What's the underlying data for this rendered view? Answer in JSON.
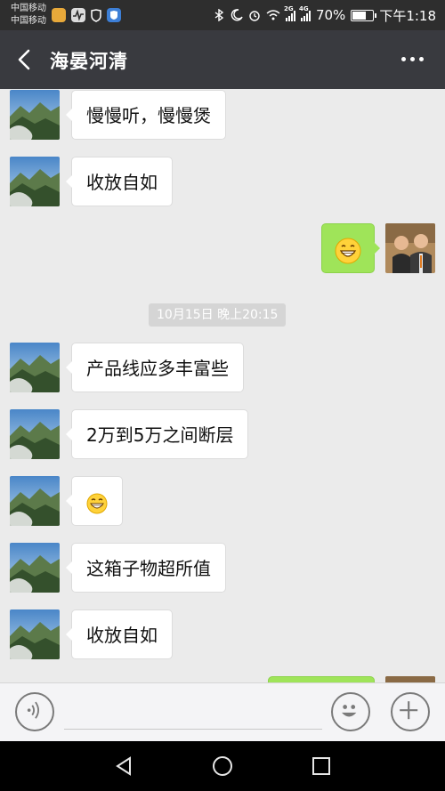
{
  "status_bar": {
    "carrier_1": "中国移动",
    "carrier_2": "中国移动",
    "signal_1_label": "2G",
    "signal_2_label": "4G",
    "battery_text": "70%",
    "battery_level": 0.7,
    "time": "下午1:18"
  },
  "nav": {
    "title": "海晏河清"
  },
  "messages": {
    "m1": "慢慢听，慢慢煲",
    "m2": "收放自如",
    "m3_emoji": "grinning-face-emoji",
    "timestamp": "10月15日 晚上20:15",
    "m4": "产品线应多丰富些",
    "m5": "2万到5万之间断层",
    "m6_emoji": "grinning-face-emoji",
    "m7": "这箱子物超所值",
    "m8": "收放自如"
  },
  "input": {
    "value": ""
  },
  "icons": {
    "voice": "voice-icon",
    "emoji": "emoji-icon",
    "plus": "plus-icon"
  },
  "colors": {
    "nav_bg": "#393a3f",
    "bubble_sent": "#9fe459",
    "bubble_received": "#ffffff",
    "chat_bg": "#ebebeb"
  }
}
